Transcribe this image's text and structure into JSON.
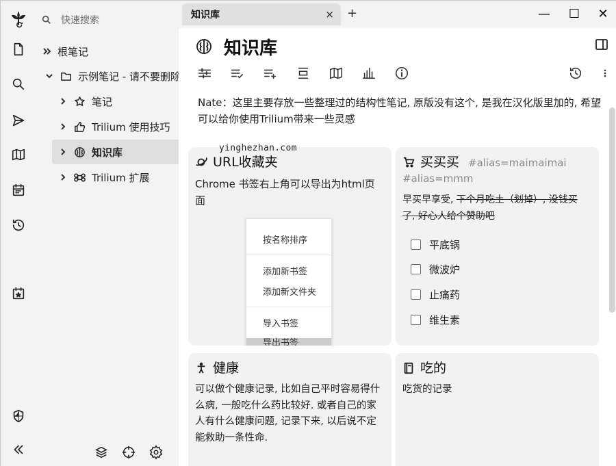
{
  "search": {
    "placeholder": "快速搜索"
  },
  "tree": {
    "items": [
      {
        "label": "根笔记",
        "level": 0
      },
      {
        "label": "示例笔记 - 请不要删除",
        "level": 1
      },
      {
        "label": "笔记",
        "level": 2
      },
      {
        "label": "Trilium 使用技巧",
        "level": 2
      },
      {
        "label": "知识库",
        "level": 2,
        "active": true
      },
      {
        "label": "Trilium 扩展",
        "level": 2
      }
    ]
  },
  "tab": {
    "label": "知识库",
    "close": "×",
    "new": "+"
  },
  "window": {
    "minimize": "—",
    "maximize": "☐",
    "close": "✕"
  },
  "note": {
    "title": "知识库",
    "intro": "Nate：这里主要存放一些整理过的结构性笔记, 原版没有这个, 是我在汉化版里加的, 希望可以给你使用Trilium带来一些灵感"
  },
  "watermark": "yinghezhan.com",
  "cards": {
    "url": {
      "title": "URL收藏夹",
      "text": "Chrome 书签右上角可以导出为html页面",
      "menu": [
        "按名称排序",
        "添加新书签",
        "添加新文件夹",
        "导入书签",
        "导出书签"
      ]
    },
    "buy": {
      "title": "买买买",
      "tags": "#alias=maimaimai #alias=mmm",
      "text_plain": "早买早享受, ",
      "text_strike": "下个月吃土（划掉）, 没钱买了, 好心人给个赞助吧",
      "checklist": [
        "平底锅",
        "微波炉",
        "止痛药",
        "维生素"
      ]
    },
    "health": {
      "title": "健康",
      "text": "可以做个健康记录, 比如自己平时容易得什么病, 一般吃什么药比较好. 或者自己的家人有什么健康问题, 记录下来, 以后说不定能救助一条性命."
    },
    "food": {
      "title": "吃的",
      "text": "吃货的记录"
    }
  }
}
